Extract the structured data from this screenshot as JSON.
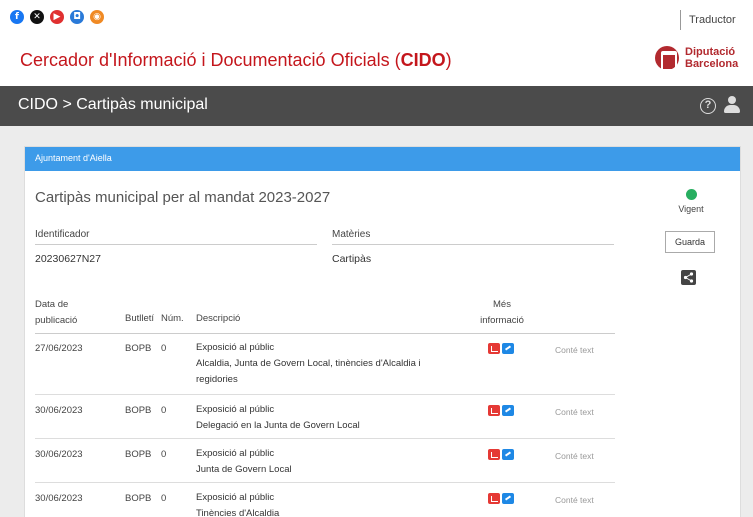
{
  "social": {
    "icons": [
      "facebook-icon",
      "x-icon",
      "youtube-icon",
      "instagram-icon",
      "rss-icon"
    ]
  },
  "translator_label": "Traductor",
  "site": {
    "title_prefix": "Cercador d'Informació i Documentació Oficials (",
    "title_bold": "CIDO",
    "title_suffix": ")",
    "logo_line1": "Diputació",
    "logo_line2": "Barcelona"
  },
  "nav": {
    "breadcrumb": "CIDO > Cartipàs municipal"
  },
  "panel": {
    "header": "Ajuntament d'Aiella",
    "title": "Cartipàs municipal per al mandat 2023-2027",
    "status": "Vigent",
    "save_label": "Guarda",
    "identifier_label": "Identificador",
    "identifier_value": "20230627N27",
    "subjects_label": "Matèries",
    "subjects_value": "Cartipàs"
  },
  "table": {
    "headers": {
      "date_line1": "Data de",
      "date_line2": "publicació",
      "bulletin": "Butlletí",
      "num": "Núm.",
      "desc": "Descripció",
      "more_line1": "Més",
      "more_line2": "informació"
    },
    "rows": [
      {
        "date": "27/06/2023",
        "bulletin": "BOPB",
        "num": "0",
        "desc1": "Exposició al públic",
        "desc2": "Alcaldia, Junta de Govern Local, tinències d'Alcaldia i",
        "desc3": "regidories",
        "has_text": "Conté text"
      },
      {
        "date": "30/06/2023",
        "bulletin": "BOPB",
        "num": "0",
        "desc1": "Exposició al públic",
        "desc2": "Delegació en la Junta de Govern Local",
        "has_text": "Conté text"
      },
      {
        "date": "30/06/2023",
        "bulletin": "BOPB",
        "num": "0",
        "desc1": "Exposició al públic",
        "desc2": "Junta de Govern Local",
        "has_text": "Conté text"
      },
      {
        "date": "30/06/2023",
        "bulletin": "BOPB",
        "num": "0",
        "desc1": "Exposició al públic",
        "desc2": "Tinències d'Alcaldia",
        "has_text": "Conté text"
      }
    ]
  }
}
